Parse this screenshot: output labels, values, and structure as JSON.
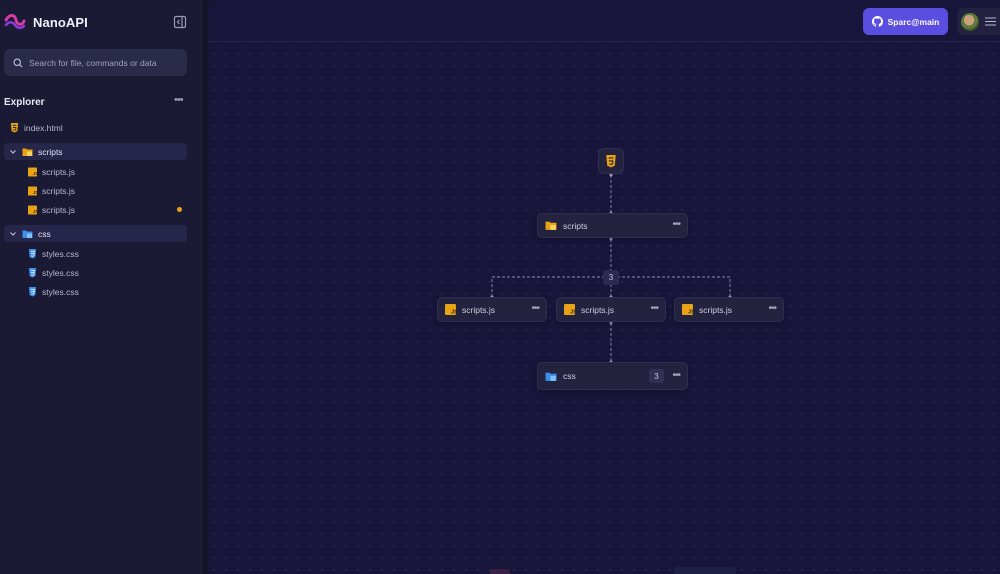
{
  "app": {
    "name": "NanoAPI"
  },
  "search": {
    "placeholder": "Search for file, commands or data"
  },
  "explorer": {
    "title": "Explorer",
    "items": [
      {
        "type": "file",
        "label": "index.html",
        "icon": "html5-icon"
      },
      {
        "type": "folder",
        "label": "scripts",
        "icon": "js-folder-icon",
        "expanded": true
      },
      {
        "type": "file",
        "label": "scripts.js",
        "icon": "js-file-icon"
      },
      {
        "type": "file",
        "label": "scripts.js",
        "icon": "js-file-icon"
      },
      {
        "type": "file",
        "label": "scripts.js",
        "icon": "js-file-icon",
        "modified": true
      },
      {
        "type": "folder",
        "label": "css",
        "icon": "css-folder-icon",
        "expanded": true
      },
      {
        "type": "file",
        "label": "styles.css",
        "icon": "css3-icon"
      },
      {
        "type": "file",
        "label": "styles.css",
        "icon": "css3-icon"
      },
      {
        "type": "file",
        "label": "styles.css",
        "icon": "css3-icon"
      }
    ]
  },
  "topbar": {
    "github_label": "Sparc@main"
  },
  "graph": {
    "root": {
      "icon": "html5-icon"
    },
    "scripts_node": {
      "label": "scripts"
    },
    "branch_count": "3",
    "children": [
      {
        "label": "scripts.js"
      },
      {
        "label": "scripts.js"
      },
      {
        "label": "scripts.js"
      }
    ],
    "css_node": {
      "label": "css",
      "count": "3"
    }
  },
  "colors": {
    "accent": "#5a4ee0",
    "background": "#15142c",
    "sidebar": "#1a1a35",
    "modified_dot": "#e8a317",
    "logo": "#d63ca8"
  }
}
